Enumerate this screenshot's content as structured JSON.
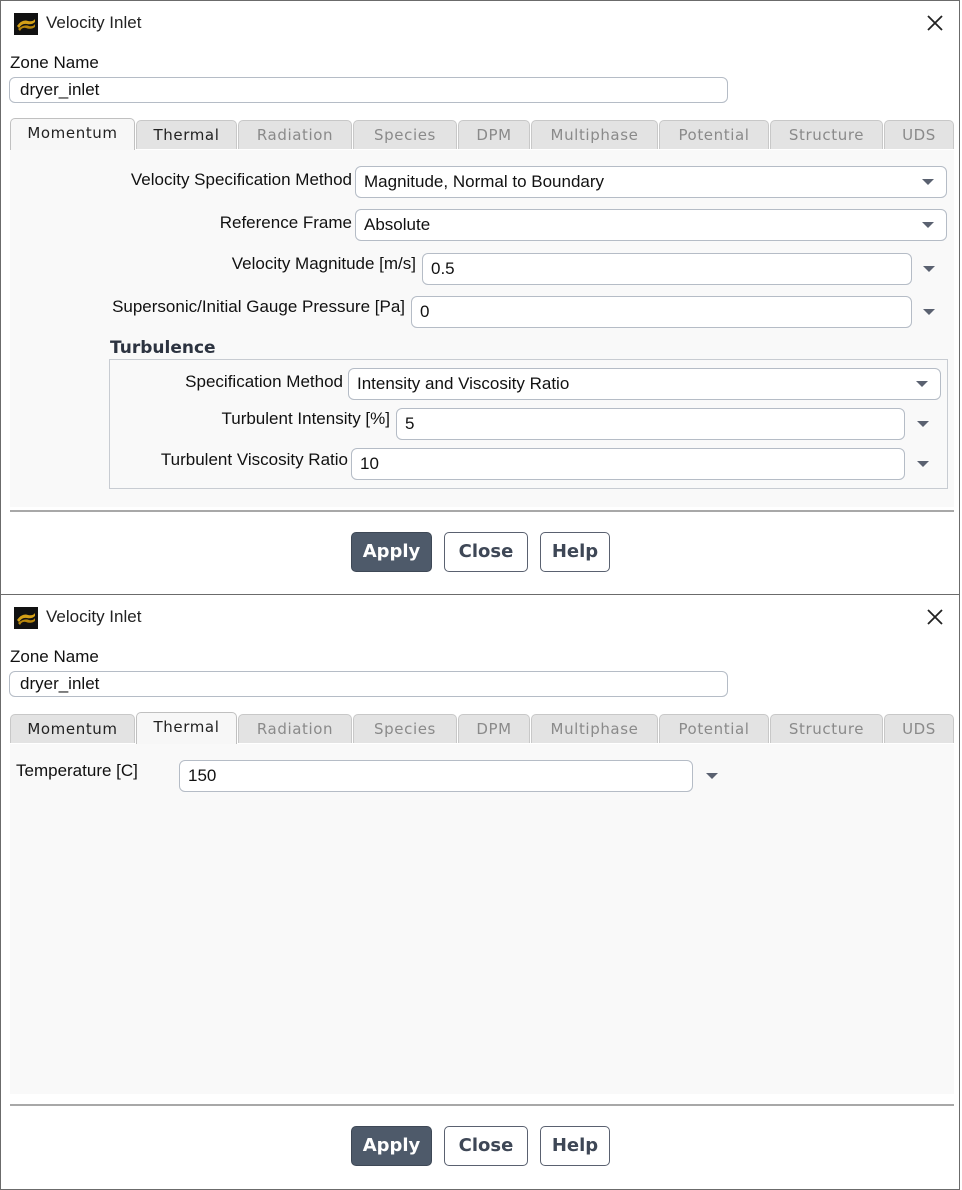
{
  "dialogs": [
    {
      "title": "Velocity Inlet",
      "zone_name_label": "Zone Name",
      "zone_name_value": "dryer_inlet",
      "tabs": [
        {
          "label": "Momentum",
          "state": "active"
        },
        {
          "label": "Thermal",
          "state": "enabled"
        },
        {
          "label": "Radiation",
          "state": "disabled"
        },
        {
          "label": "Species",
          "state": "disabled"
        },
        {
          "label": "DPM",
          "state": "disabled"
        },
        {
          "label": "Multiphase",
          "state": "disabled"
        },
        {
          "label": "Potential",
          "state": "disabled"
        },
        {
          "label": "Structure",
          "state": "disabled"
        },
        {
          "label": "UDS",
          "state": "disabled"
        }
      ],
      "momentum": {
        "velocity_spec_label": "Velocity Specification Method",
        "velocity_spec_value": "Magnitude, Normal to Boundary",
        "reference_frame_label": "Reference Frame",
        "reference_frame_value": "Absolute",
        "velocity_magnitude_label": "Velocity Magnitude [m/s]",
        "velocity_magnitude_value": "0.5",
        "gauge_pressure_label": "Supersonic/Initial Gauge Pressure [Pa]",
        "gauge_pressure_value": "0",
        "turbulence": {
          "title": "Turbulence",
          "spec_method_label": "Specification Method",
          "spec_method_value": "Intensity and Viscosity Ratio",
          "intensity_label": "Turbulent Intensity [%]",
          "intensity_value": "5",
          "viscosity_ratio_label": "Turbulent Viscosity Ratio",
          "viscosity_ratio_value": "10"
        }
      },
      "buttons": {
        "apply": "Apply",
        "close": "Close",
        "help": "Help"
      }
    },
    {
      "title": "Velocity Inlet",
      "zone_name_label": "Zone Name",
      "zone_name_value": "dryer_inlet",
      "tabs": [
        {
          "label": "Momentum",
          "state": "enabled"
        },
        {
          "label": "Thermal",
          "state": "active"
        },
        {
          "label": "Radiation",
          "state": "disabled"
        },
        {
          "label": "Species",
          "state": "disabled"
        },
        {
          "label": "DPM",
          "state": "disabled"
        },
        {
          "label": "Multiphase",
          "state": "disabled"
        },
        {
          "label": "Potential",
          "state": "disabled"
        },
        {
          "label": "Structure",
          "state": "disabled"
        },
        {
          "label": "UDS",
          "state": "disabled"
        }
      ],
      "thermal": {
        "temperature_label": "Temperature [C]",
        "temperature_value": "150"
      },
      "buttons": {
        "apply": "Apply",
        "close": "Close",
        "help": "Help"
      }
    }
  ],
  "colors": {
    "primary_button": "#4e5a6a",
    "icon_gold": "#d4a017"
  }
}
